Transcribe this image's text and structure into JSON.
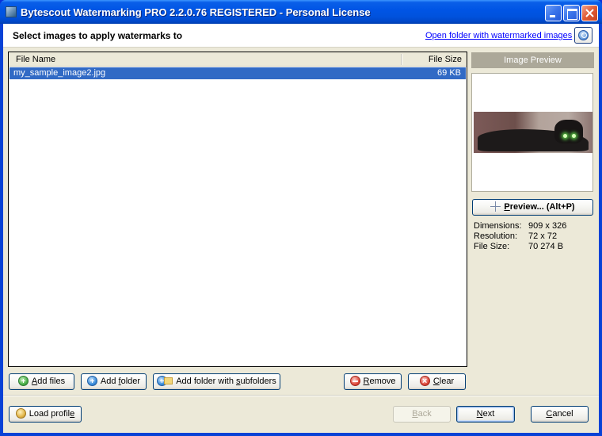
{
  "window": {
    "title": "Bytescout Watermarking PRO 2.2.0.76 REGISTERED - Personal License",
    "controls": {
      "minimize": "minimize",
      "maximize": "maximize",
      "close": "close"
    }
  },
  "header": {
    "title": "Select images to apply watermarks to",
    "open_folder_link": "Open folder with watermarked images",
    "help_icon": "help-icon"
  },
  "file_list": {
    "columns": [
      "File Name",
      "File Size"
    ],
    "rows": [
      {
        "name": "my_sample_image2.jpg",
        "size": "69 KB",
        "selected": true
      }
    ]
  },
  "preview": {
    "title": "Image Preview",
    "preview_button": {
      "label_underlined": "P",
      "label_rest": "review... (Alt+P)"
    },
    "info": [
      {
        "label": "Dimensions:",
        "value": "909 x 326"
      },
      {
        "label": "Resolution:",
        "value": "72 x 72"
      },
      {
        "label": "File Size:",
        "value": "70 274 B"
      }
    ]
  },
  "list_buttons": {
    "add_files": {
      "pre": "",
      "u": "A",
      "post": "dd files"
    },
    "add_folder": {
      "pre": "Add ",
      "u": "f",
      "post": "older"
    },
    "add_folder_sub": {
      "pre": "Add folder with ",
      "u": "s",
      "post": "ubfolders"
    },
    "remove": {
      "pre": "",
      "u": "R",
      "post": "emove"
    },
    "clear": {
      "pre": "",
      "u": "C",
      "post": "lear"
    }
  },
  "footer": {
    "load_profile": {
      "pre": "Load profil",
      "u": "e",
      "post": ""
    },
    "back": {
      "pre": "",
      "u": "B",
      "post": "ack",
      "disabled": true
    },
    "next": {
      "pre": "",
      "u": "N",
      "post": "ext"
    },
    "cancel": {
      "pre": "",
      "u": "C",
      "post": "ancel"
    }
  }
}
